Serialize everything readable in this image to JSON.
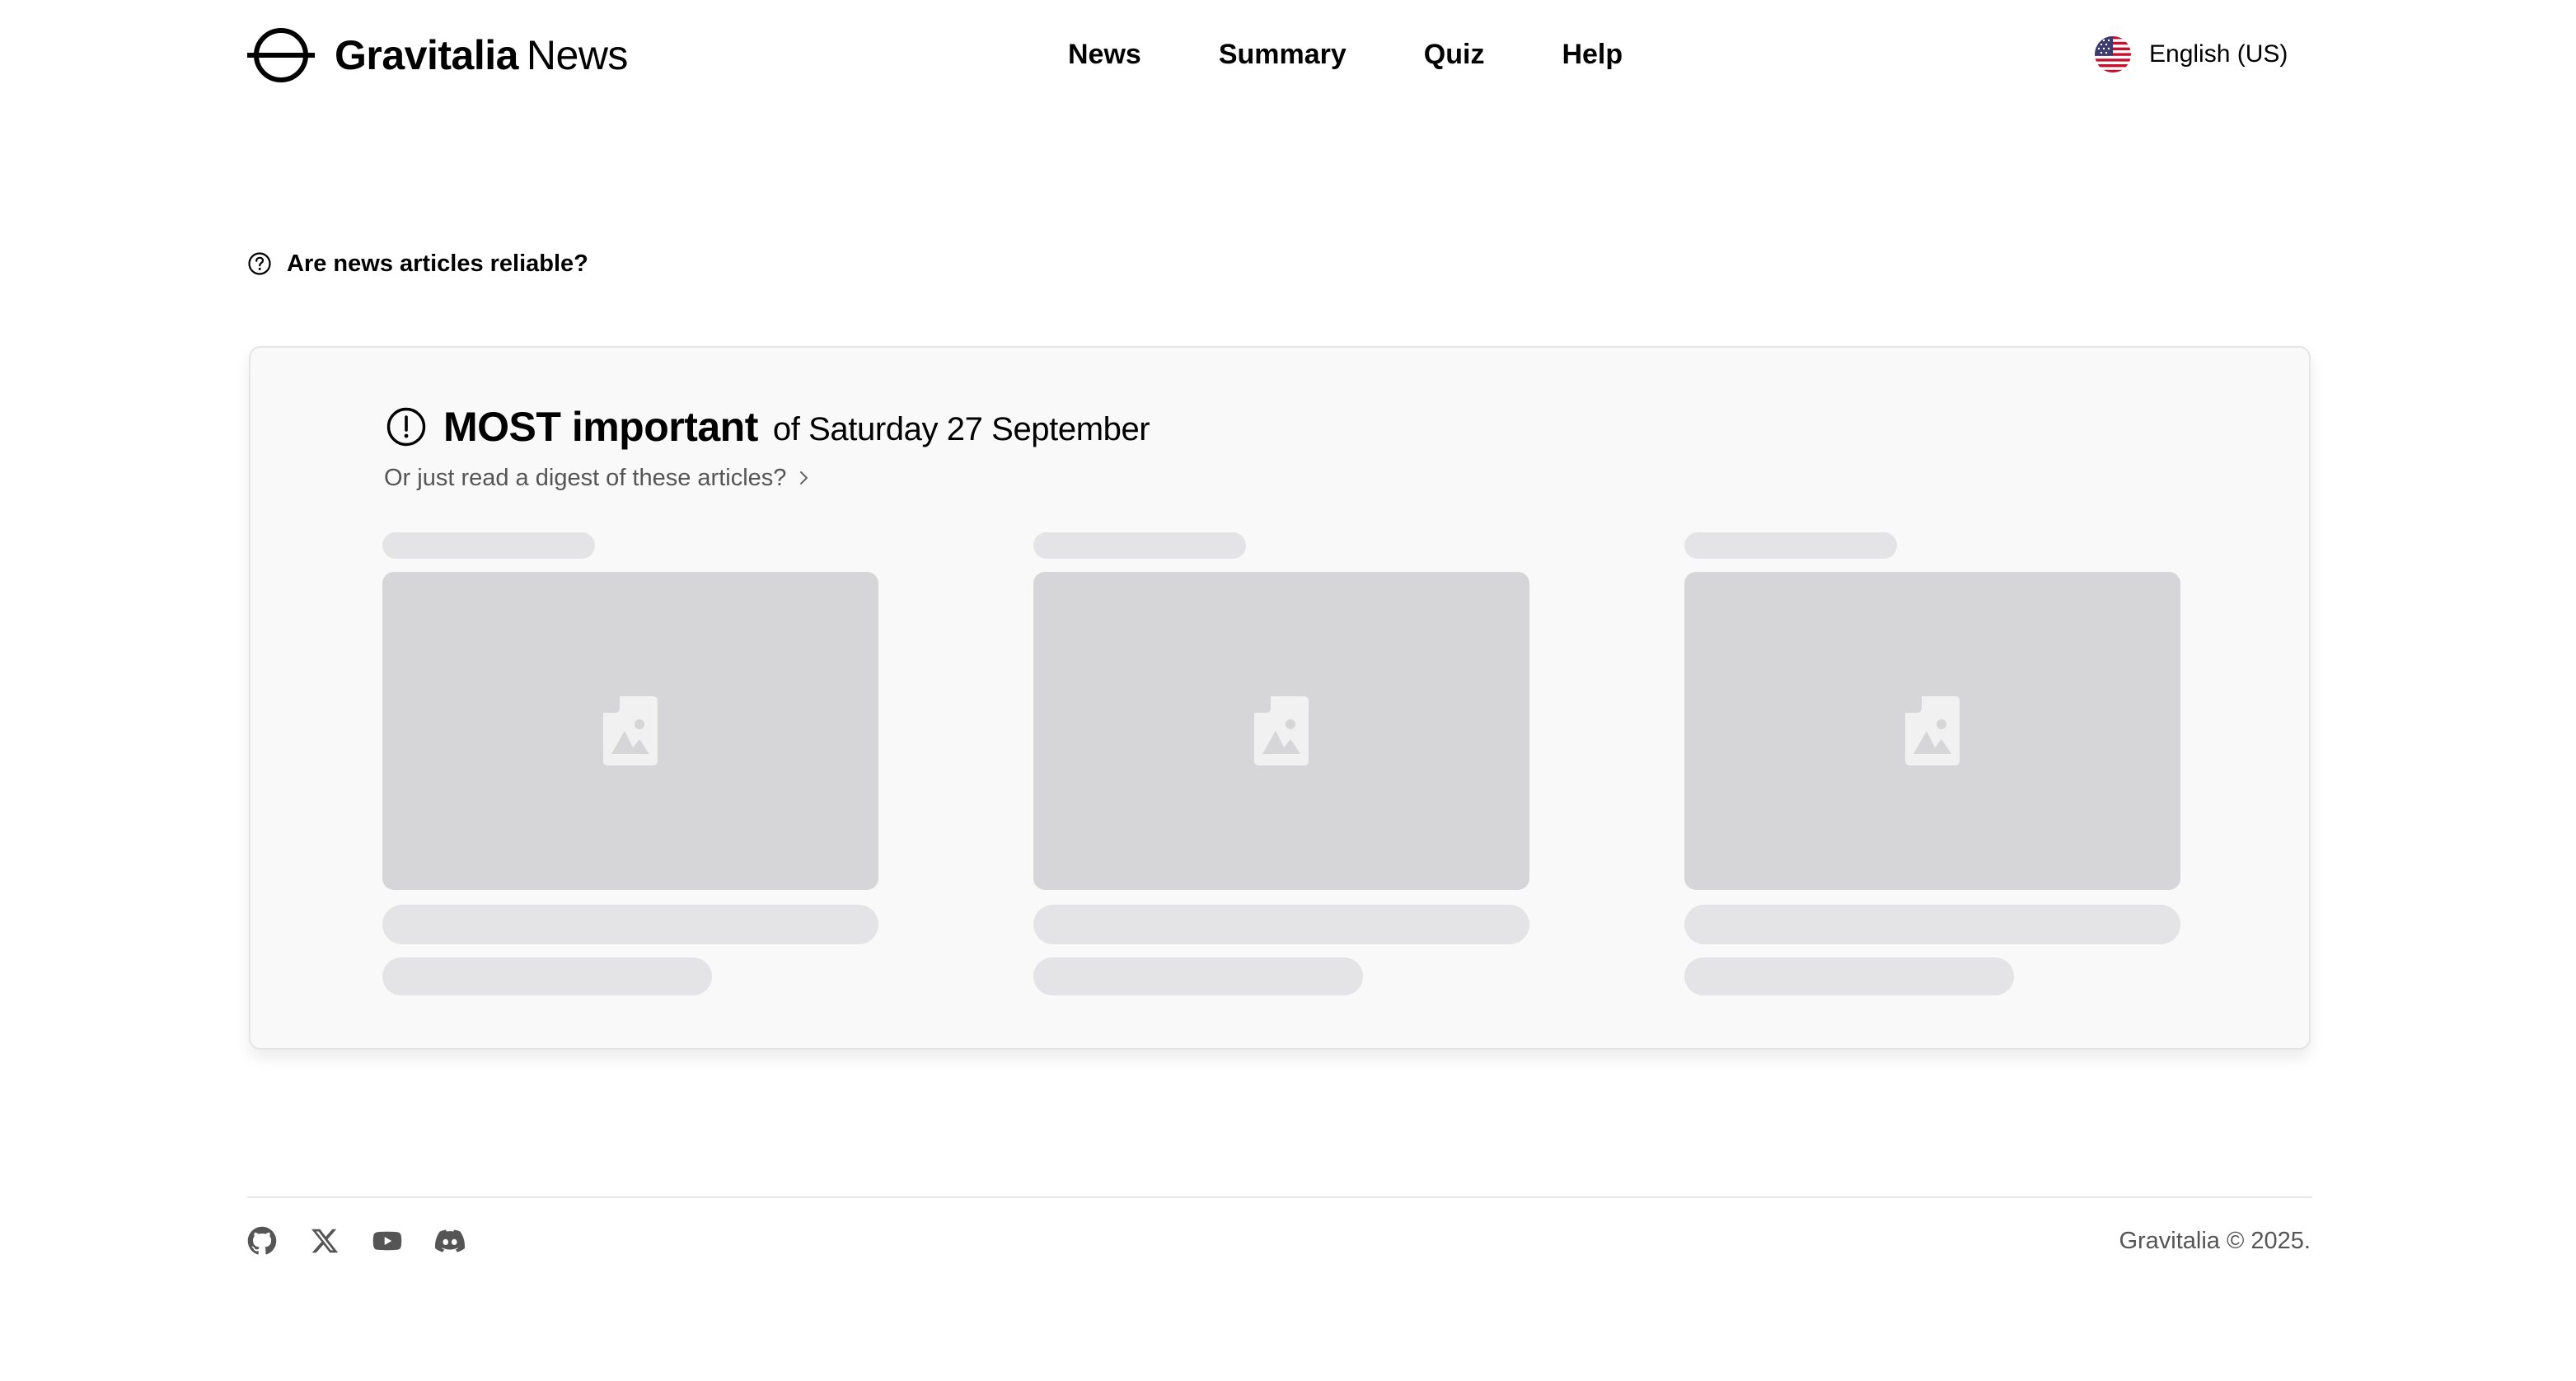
{
  "brand": {
    "name_strong": "Gravitalia",
    "name_light": "News",
    "logo_icon": "gravitalia-planet-logo"
  },
  "nav": {
    "items": [
      {
        "label": "News"
      },
      {
        "label": "Summary"
      },
      {
        "label": "Quiz"
      },
      {
        "label": "Help"
      }
    ]
  },
  "language": {
    "label": "English (US)",
    "flag_icon": "us-flag-icon"
  },
  "reliability": {
    "label": "Are news articles reliable?",
    "icon": "question-circle-icon"
  },
  "most_important": {
    "title_strong": "MOST important",
    "title_rest": "of Saturday 27 September",
    "digest_link": "Or just read a digest of these articles?",
    "icon": "exclamation-circle-icon",
    "articles_state": "loading",
    "article_placeholders": 3
  },
  "footer": {
    "social": [
      {
        "name": "GitHub",
        "icon": "github-icon"
      },
      {
        "name": "X",
        "icon": "x-icon"
      },
      {
        "name": "YouTube",
        "icon": "youtube-icon"
      },
      {
        "name": "Discord",
        "icon": "discord-icon"
      }
    ],
    "copyright": "Gravitalia © 2025."
  },
  "colors": {
    "text": "#000000",
    "muted_text": "#555555",
    "card_bg": "#f9f9f9",
    "card_border": "#e5e5e5",
    "skeleton_light": "#e4e4e6",
    "skeleton_dark": "#d6d6d9"
  }
}
